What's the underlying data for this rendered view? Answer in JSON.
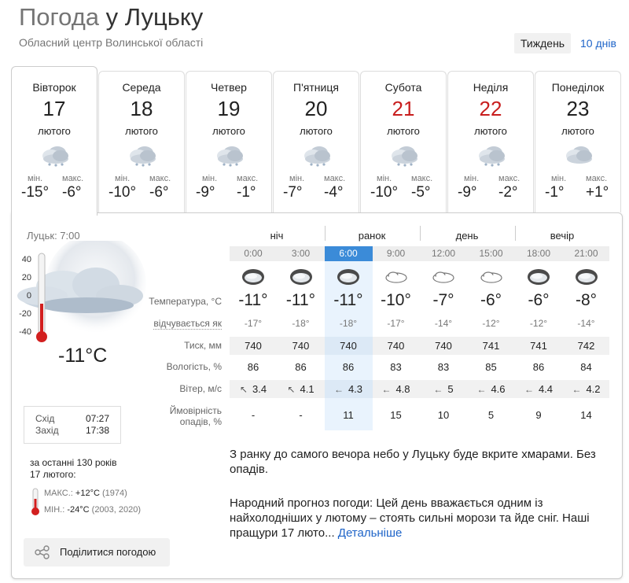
{
  "header": {
    "title_prefix": "Погода",
    "title_city": "у Луцьку",
    "subtitle": "Обласний центр Волинської області",
    "range_week": "Тиждень",
    "range_10": "10 днів"
  },
  "days": [
    {
      "name": "Вівторок",
      "num": "17",
      "month": "лютого",
      "min_label": "мін.",
      "max_label": "макс.",
      "min": "-15°",
      "max": "-6°",
      "weekend": false,
      "icon": "cloudy-snow-icon"
    },
    {
      "name": "Середа",
      "num": "18",
      "month": "лютого",
      "min_label": "мін.",
      "max_label": "макс.",
      "min": "-10°",
      "max": "-6°",
      "weekend": false,
      "icon": "cloudy-snow-icon"
    },
    {
      "name": "Четвер",
      "num": "19",
      "month": "лютого",
      "min_label": "мін.",
      "max_label": "макс.",
      "min": "-9°",
      "max": "-1°",
      "weekend": false,
      "icon": "cloudy-snow-icon"
    },
    {
      "name": "П'ятниця",
      "num": "20",
      "month": "лютого",
      "min_label": "мін.",
      "max_label": "макс.",
      "min": "-7°",
      "max": "-4°",
      "weekend": false,
      "icon": "cloudy-snow-icon"
    },
    {
      "name": "Субота",
      "num": "21",
      "month": "лютого",
      "min_label": "мін.",
      "max_label": "макс.",
      "min": "-10°",
      "max": "-5°",
      "weekend": true,
      "icon": "cloudy-snow-icon"
    },
    {
      "name": "Неділя",
      "num": "22",
      "month": "лютого",
      "min_label": "мін.",
      "max_label": "макс.",
      "min": "-9°",
      "max": "-2°",
      "weekend": true,
      "icon": "cloudy-snow-icon"
    },
    {
      "name": "Понеділок",
      "num": "23",
      "month": "лютого",
      "min_label": "мін.",
      "max_label": "макс.",
      "min": "-1°",
      "max": "+1°",
      "weekend": false,
      "icon": "cloudy-icon"
    }
  ],
  "current": {
    "time": "Луцьк: 7:00",
    "temp": "-11°C",
    "scale": [
      "40",
      "20",
      "0",
      "-20",
      "-40"
    ],
    "thermo_level": 0.36,
    "sunrise_label": "Схід",
    "sunrise": "07:27",
    "sunset_label": "Захід",
    "sunset": "17:38"
  },
  "history": {
    "line1": "за останні 130 років",
    "line2": "17 лютого:",
    "max_label": "МАКС.:",
    "max_val": "+12°C",
    "max_year": "(1974)",
    "min_label": "МІН.:",
    "min_val": "-24°C",
    "min_year": "(2003, 2020)"
  },
  "share_label": "Поділитися погодою",
  "periods": [
    "ніч",
    "ранок",
    "день",
    "вечір"
  ],
  "times": [
    "0:00",
    "3:00",
    "6:00",
    "9:00",
    "12:00",
    "15:00",
    "18:00",
    "21:00"
  ],
  "active_time_index": 2,
  "row_labels": {
    "temp": "Температура, °C",
    "feels": "відчувається як",
    "pressure": "Тиск, мм",
    "humidity": "Вологість, %",
    "wind": "Вітер, м/с",
    "precip_1": "Ймовірність",
    "precip_2": "опадів, %"
  },
  "hourly": {
    "icons": [
      "overcast-icon",
      "overcast-icon",
      "overcast-icon",
      "cloud-icon",
      "cloud-icon",
      "cloud-icon",
      "overcast-icon",
      "overcast-icon"
    ],
    "temp": [
      "-11°",
      "-11°",
      "-11°",
      "-10°",
      "-7°",
      "-6°",
      "-6°",
      "-8°"
    ],
    "feels": [
      "-17°",
      "-18°",
      "-18°",
      "-17°",
      "-14°",
      "-12°",
      "-12°",
      "-14°"
    ],
    "pressure": [
      "740",
      "740",
      "740",
      "740",
      "740",
      "741",
      "741",
      "742"
    ],
    "humidity": [
      "86",
      "86",
      "86",
      "83",
      "83",
      "85",
      "86",
      "84"
    ],
    "wind": [
      "3.4",
      "4.1",
      "4.3",
      "4.8",
      "5",
      "4.6",
      "4.4",
      "4.2"
    ],
    "wind_dir": [
      "↖",
      "↖",
      "←",
      "←",
      "←",
      "←",
      "←",
      "←"
    ],
    "precip": [
      "-",
      "-",
      "11",
      "15",
      "10",
      "5",
      "9",
      "14"
    ]
  },
  "description": "З ранку до самого вечора небо у Луцьку буде вкрите хмарами. Без опадів.",
  "folk": {
    "label": "Народний прогноз погоди:",
    "text": " Цей день вважається одним із найхолодніших у лютому – стоять сильні морози та йде сніг. Наші пращури 17 люто...",
    "link": "Детальніше"
  },
  "colors": {
    "accent": "#3b8bd8",
    "link": "#1e64c8",
    "weekend": "#c81e1e"
  }
}
